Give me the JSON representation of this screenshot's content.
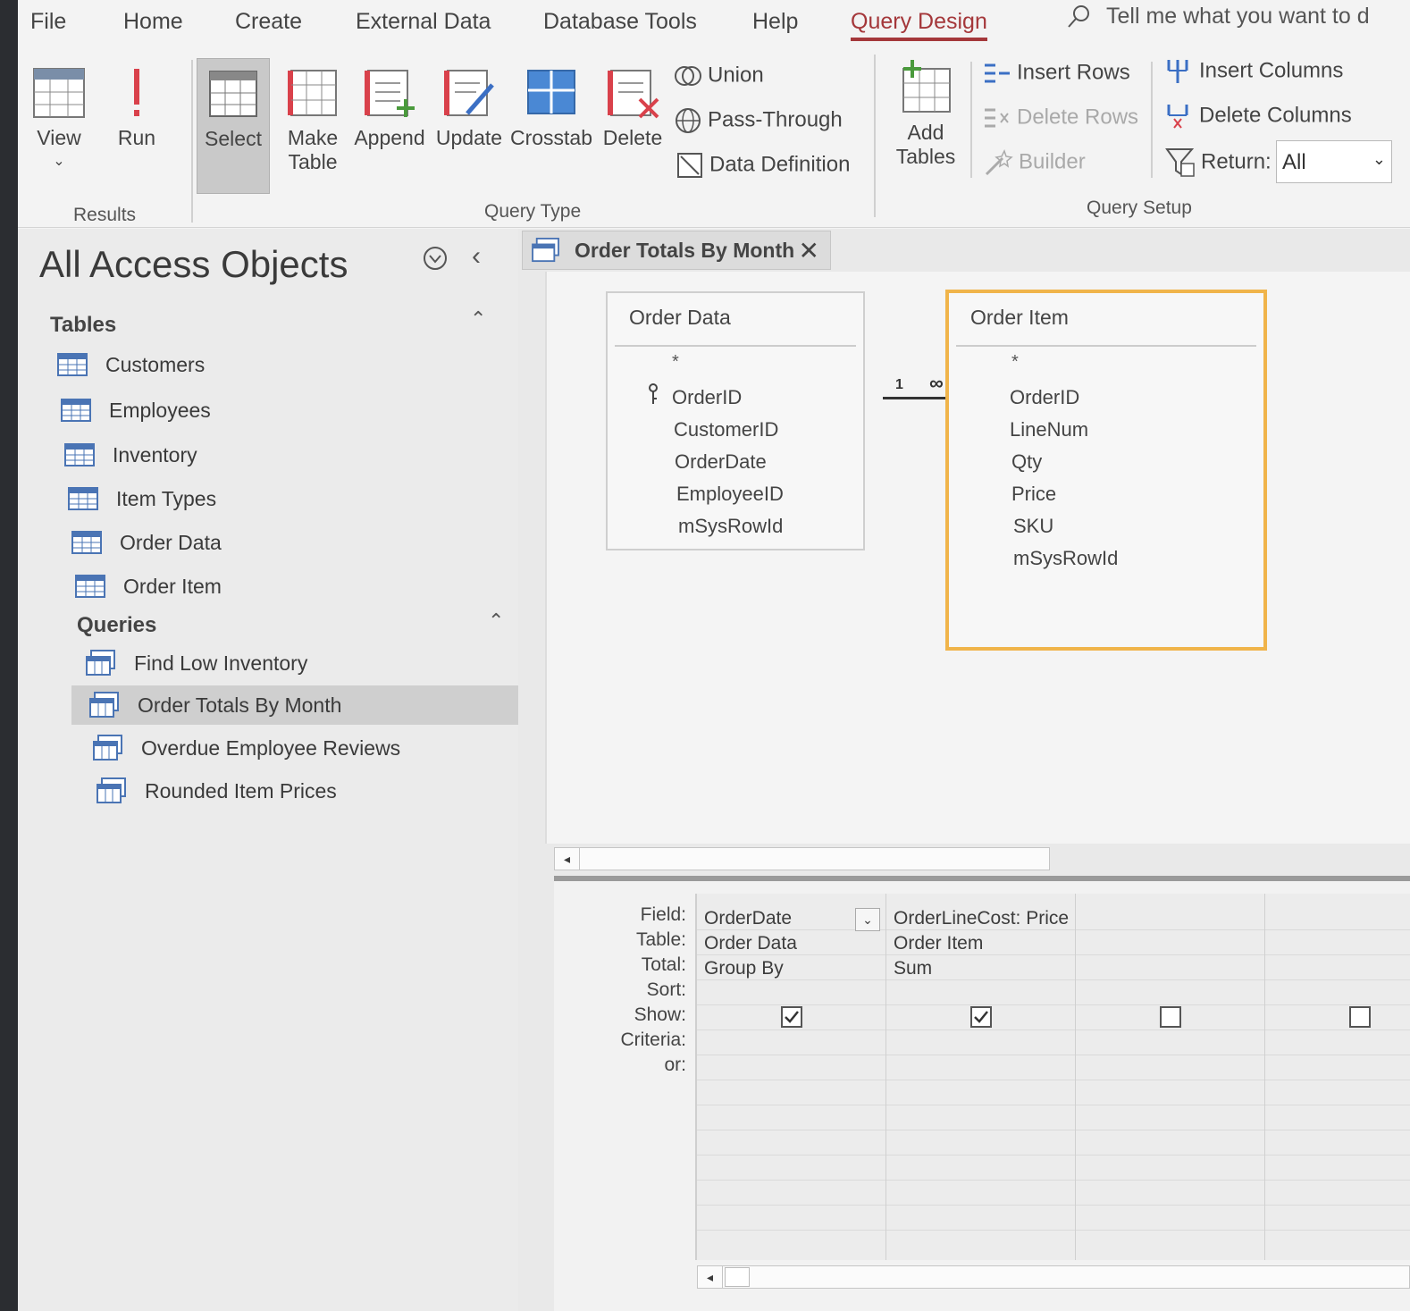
{
  "ribbon_tabs": [
    "File",
    "Home",
    "Create",
    "External Data",
    "Database Tools",
    "Help",
    "Query Design"
  ],
  "tell_me": "Tell me what you want to d",
  "results_group": {
    "view_label": "View",
    "run_label": "Run",
    "label": "Results"
  },
  "query_type_group": {
    "select": "Select",
    "make": "Make",
    "table": "Table",
    "append": "Append",
    "update": "Update",
    "crosstab": "Crosstab",
    "delete": "Delete",
    "union": "Union",
    "pass_through": "Pass-Through",
    "data_definition": "Data Definition",
    "label": "Query Type"
  },
  "query_setup_group": {
    "add": "Add",
    "tables": "Tables",
    "insert_rows": "Insert Rows",
    "delete_rows": "Delete Rows",
    "builder": "Builder",
    "insert_columns": "Insert Columns",
    "delete_columns": "Delete Columns",
    "return_label": "Return:",
    "return_value": "All",
    "label": "Query Setup"
  },
  "nav": {
    "title": "All Access Objects",
    "tables_header": "Tables",
    "tables": [
      "Customers",
      "Employees",
      "Inventory",
      "Item Types",
      "Order Data",
      "Order Item"
    ],
    "queries_header": "Queries",
    "queries": [
      "Find Low Inventory",
      "Order Totals By Month",
      "Overdue Employee Reviews",
      "Rounded Item Prices"
    ],
    "selected_query": "Order Totals By Month"
  },
  "document_tab": "Order Totals By Month",
  "order_data_table": {
    "title": "Order Data",
    "star": "*",
    "fields": [
      "OrderID",
      "CustomerID",
      "OrderDate",
      "EmployeeID",
      "mSysRowId"
    ],
    "key_field": "OrderID"
  },
  "order_item_table": {
    "title": "Order Item",
    "star": "*",
    "fields": [
      "OrderID",
      "LineNum",
      "Qty",
      "Price",
      "SKU",
      "mSysRowId"
    ]
  },
  "join": {
    "one": "1",
    "many": "∞"
  },
  "grid": {
    "row_labels": [
      "Field:",
      "Table:",
      "Total:",
      "Sort:",
      "Show:",
      "Criteria:",
      "or:"
    ],
    "columns": [
      {
        "field": "OrderDate",
        "table": "Order Data",
        "total": "Group By",
        "show": true
      },
      {
        "field": "OrderLineCost: Price",
        "table": "Order Item",
        "total": "Sum",
        "show": true
      },
      {
        "field": "",
        "table": "",
        "total": "",
        "show": false
      },
      {
        "field": "",
        "table": "",
        "total": "",
        "show": false
      }
    ]
  },
  "colors": {
    "accent": "#a4373a",
    "selected_table_border": "#f0b44a"
  }
}
